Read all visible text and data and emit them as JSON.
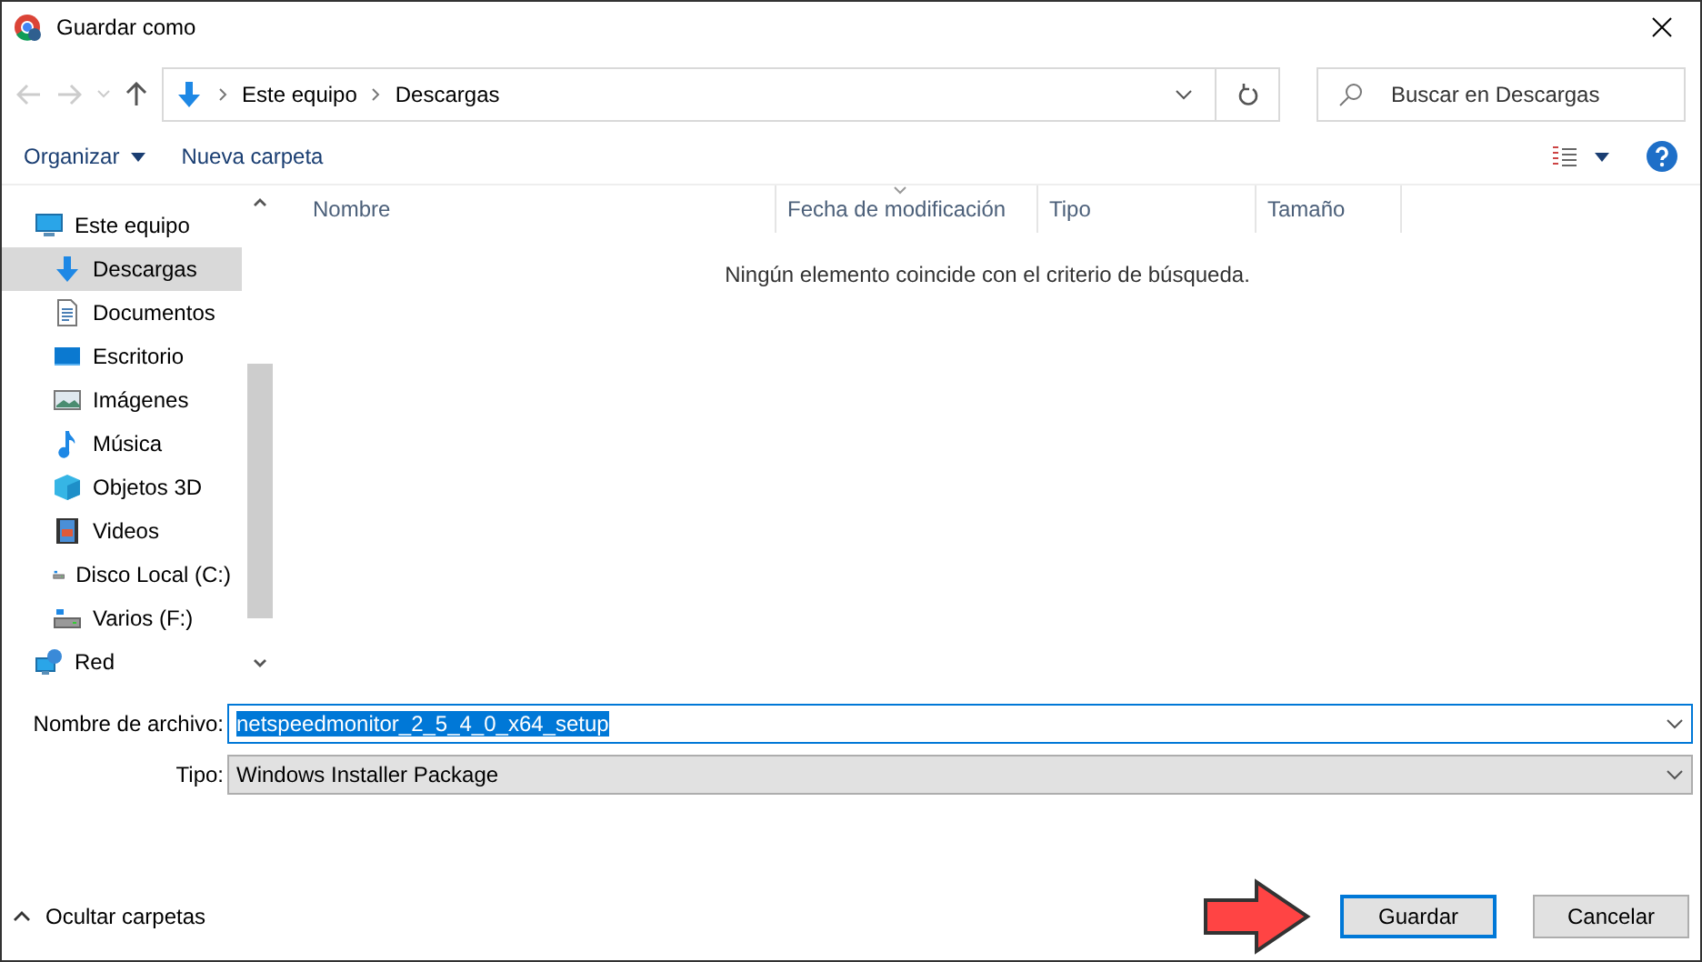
{
  "window": {
    "title": "Guardar como"
  },
  "address": {
    "path": [
      "Este equipo",
      "Descargas"
    ]
  },
  "search": {
    "placeholder": "Buscar en Descargas"
  },
  "toolbar": {
    "organize": "Organizar",
    "new_folder": "Nueva carpeta"
  },
  "sidebar": {
    "items": [
      {
        "label": "Este equipo",
        "kind": "computer",
        "selected": false,
        "children": [
          {
            "label": "Descargas",
            "kind": "download",
            "selected": true
          },
          {
            "label": "Documentos",
            "kind": "document",
            "selected": false
          },
          {
            "label": "Escritorio",
            "kind": "desktop",
            "selected": false
          },
          {
            "label": "Imágenes",
            "kind": "images",
            "selected": false
          },
          {
            "label": "Música",
            "kind": "music",
            "selected": false
          },
          {
            "label": "Objetos 3D",
            "kind": "cube",
            "selected": false
          },
          {
            "label": "Videos",
            "kind": "video",
            "selected": false
          },
          {
            "label": "Disco Local (C:)",
            "kind": "drive",
            "selected": false
          },
          {
            "label": "Varios (F:)",
            "kind": "drive",
            "selected": false
          }
        ]
      },
      {
        "label": "Red",
        "kind": "network",
        "selected": false
      }
    ]
  },
  "table": {
    "columns": [
      {
        "label": "Nombre",
        "sorted": false
      },
      {
        "label": "Fecha de modificación",
        "sorted": true
      },
      {
        "label": "Tipo",
        "sorted": false
      },
      {
        "label": "Tamaño",
        "sorted": false
      }
    ],
    "empty_message": "Ningún elemento coincide con el criterio de búsqueda."
  },
  "form": {
    "filename_label": "Nombre de archivo:",
    "filename": "netspeedmonitor_2_5_4_0_x64_setup",
    "type_label": "Tipo:",
    "type": "Windows Installer Package"
  },
  "footer": {
    "toggle": "Ocultar carpetas",
    "buttons": [
      {
        "label": "Guardar",
        "default": true
      },
      {
        "label": "Cancelar",
        "default": false
      }
    ]
  }
}
